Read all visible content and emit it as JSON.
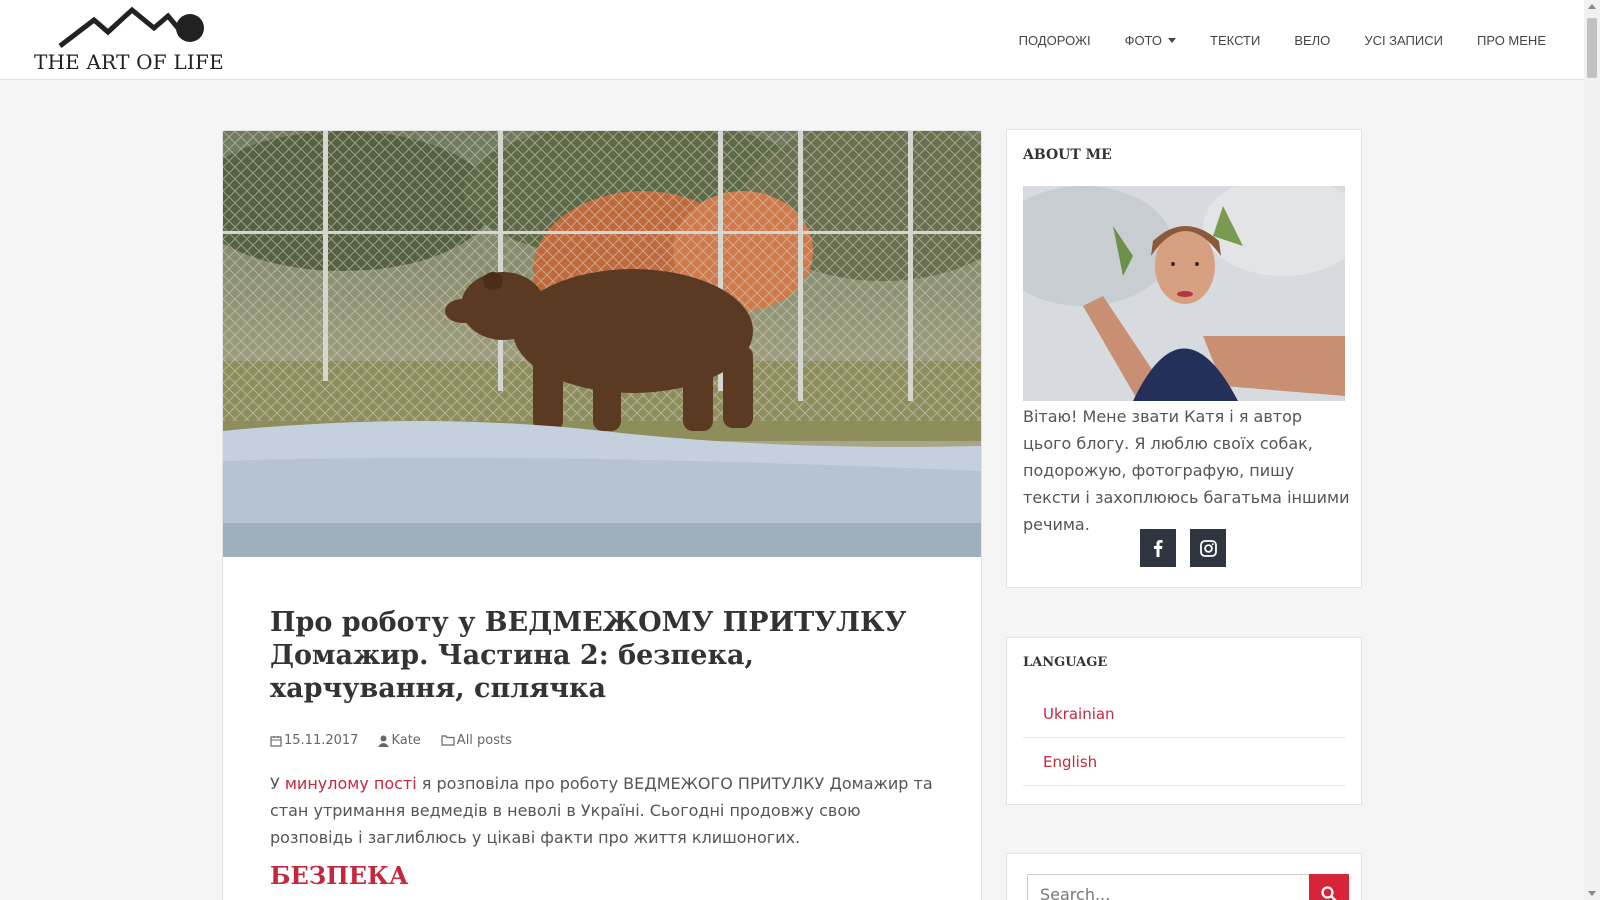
{
  "site": {
    "logo_text": "THE ART OF LIFE"
  },
  "nav": {
    "items": [
      {
        "label": "ПОДОРОЖІ"
      },
      {
        "label": "ФОТО"
      },
      {
        "label": "ТЕКСТИ"
      },
      {
        "label": "ВЕЛО"
      },
      {
        "label": "УСІ ЗАПИСИ"
      },
      {
        "label": "ПРО МЕНЕ"
      }
    ]
  },
  "post": {
    "title": "Про роботу у ВЕДМЕЖОМУ ПРИТУЛКУ Домажир. Частина 2: безпека, харчування, сплячка",
    "date": "15.11.2017",
    "author": "Kate",
    "category": "All posts",
    "excerpt_before": "У ",
    "excerpt_link": "минулому пості",
    "excerpt_after": " я розповіла про роботу ВЕДМЕЖОГО ПРИТУЛКУ Домажир та стан утримання ведмедів в неволі в Україні. Сьогодні продовжу свою розповідь і заглиблюсь у цікаві факти про життя клишоногих.",
    "section_heading": "БЕЗПЕКА"
  },
  "sidebar": {
    "about": {
      "title": "ABOUT ME",
      "text": "Вітаю! Мене звати Катя і я автор цього блогу. Я люблю своїх собак, подорожую, фотографую, пишу тексти і захоплююсь багатьма іншими речима."
    },
    "language": {
      "title": "LANGUAGE",
      "items": [
        {
          "label": "Ukrainian"
        },
        {
          "label": "English"
        }
      ]
    },
    "search": {
      "placeholder": "Search..."
    }
  },
  "colors": {
    "accent": "#c5283d",
    "social_bg": "#2f3640",
    "page_bg": "#f5f5f5"
  },
  "icons": {
    "social": [
      "facebook-icon",
      "instagram-icon"
    ],
    "meta": [
      "calendar-icon",
      "user-icon",
      "folder-icon"
    ],
    "search": "search-icon"
  }
}
